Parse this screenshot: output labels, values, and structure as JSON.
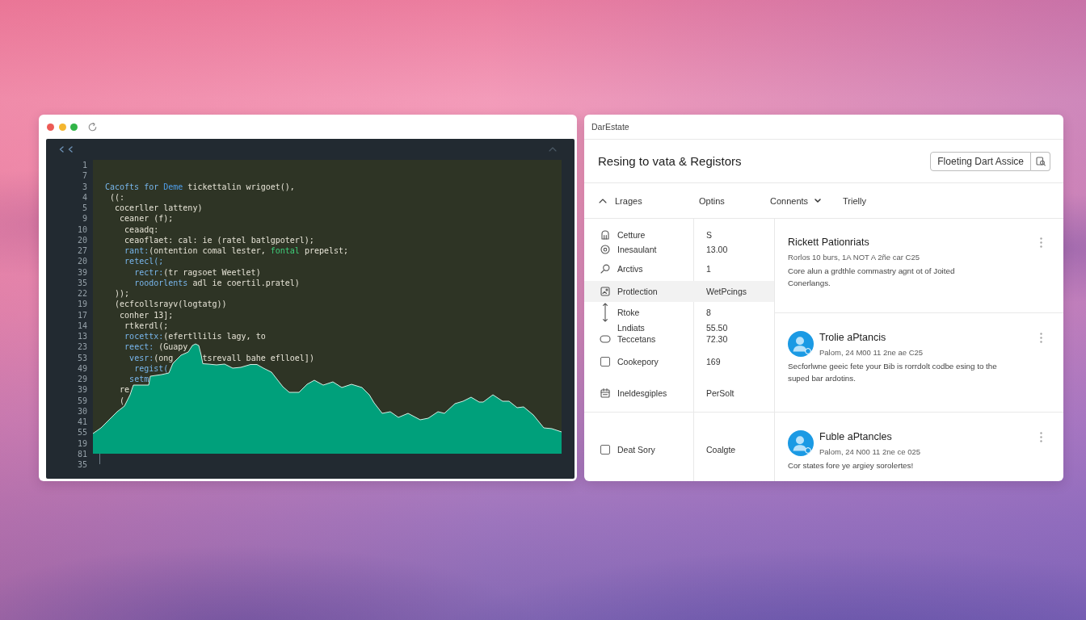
{
  "editor": {
    "code_panel": {
      "lines": [
        {
          "number": "1"
        },
        {
          "number": "7"
        },
        {
          "number": "3",
          "tokens": [
            {
              "kind": "keyword",
              "text": "Cacofts for"
            },
            {
              "kind": "type",
              "text": " Deme"
            },
            {
              "kind": "plain",
              "text": " tickettalin wrigoet(),"
            }
          ]
        },
        {
          "number": "4",
          "tokens": [
            {
              "kind": "plain",
              "text": " ((:"
            }
          ]
        },
        {
          "number": "5",
          "tokens": [
            {
              "kind": "plain",
              "text": "  cocerller latteny)"
            }
          ]
        },
        {
          "number": "9",
          "tokens": [
            {
              "kind": "plain",
              "text": "   ceaner (f);"
            }
          ]
        },
        {
          "number": "10",
          "tokens": [
            {
              "kind": "plain",
              "text": "    ceaadq:"
            }
          ]
        },
        {
          "number": "20",
          "tokens": [
            {
              "kind": "plain",
              "text": "    ceaoflaet: cal: ie (ratel batlgpoterl);"
            }
          ]
        },
        {
          "number": "27",
          "tokens": [
            {
              "kind": "keyword",
              "text": "    rant:"
            },
            {
              "kind": "plain",
              "text": "(ontention comal lester,"
            },
            {
              "kind": "string",
              "text": " fontal"
            },
            {
              "kind": "plain",
              "text": " prepelst;"
            }
          ]
        },
        {
          "number": "20",
          "tokens": [
            {
              "kind": "keyword",
              "text": "    retecl(;"
            }
          ]
        },
        {
          "number": "39",
          "tokens": [
            {
              "kind": "keyword",
              "text": "      rectr:"
            },
            {
              "kind": "plain",
              "text": "(tr ragsoet Weetlet)"
            }
          ]
        },
        {
          "number": "35",
          "tokens": [
            {
              "kind": "keyword",
              "text": "      roodorlents"
            },
            {
              "kind": "plain",
              "text": " adl ie coertil.pratel)"
            }
          ]
        },
        {
          "number": "22",
          "tokens": [
            {
              "kind": "plain",
              "text": "  ));"
            }
          ]
        },
        {
          "number": "19",
          "tokens": [
            {
              "kind": "plain",
              "text": "  (ecfcollsrayv(logtatg))"
            }
          ]
        },
        {
          "number": "17",
          "tokens": [
            {
              "kind": "plain",
              "text": "   conher 13];"
            }
          ]
        },
        {
          "number": "14",
          "tokens": [
            {
              "kind": "plain",
              "text": "    rtkerdl(;"
            }
          ]
        },
        {
          "number": "13",
          "tokens": [
            {
              "kind": "keyword",
              "text": "    rocettx:"
            },
            {
              "kind": "plain",
              "text": "(efertllilis lagy, to"
            }
          ]
        },
        {
          "number": "23",
          "tokens": [
            {
              "kind": "keyword",
              "text": "    reect:"
            },
            {
              "kind": "plain",
              "text": " (Guapy"
            }
          ]
        },
        {
          "number": "53",
          "tokens": [
            {
              "kind": "keyword",
              "text": "     vesr:"
            },
            {
              "kind": "plain",
              "text": "(ong"
            },
            {
              "kind": "plain",
              "text": "      tsrevall bahe eflloel])"
            }
          ]
        },
        {
          "number": "49",
          "tokens": [
            {
              "kind": "keyword",
              "text": "      regist("
            }
          ]
        },
        {
          "number": "29",
          "tokens": [
            {
              "kind": "keyword",
              "text": "     setm"
            }
          ]
        },
        {
          "number": "39",
          "tokens": [
            {
              "kind": "plain",
              "text": "   re"
            }
          ]
        },
        {
          "number": "59",
          "tokens": [
            {
              "kind": "plain",
              "text": "   ("
            }
          ]
        },
        {
          "number": "30"
        },
        {
          "number": "41"
        },
        {
          "number": "55"
        },
        {
          "number": "19"
        }
      ]
    },
    "trailing_lines": [
      {
        "number": "81",
        "cursor": true
      },
      {
        "number": "35",
        "cursor": false
      }
    ]
  },
  "panel": {
    "title": "DarEstate",
    "heading": "Resing to vata & Registors",
    "action": "Floeting Dart Assice",
    "columns": [
      {
        "label": "Lrages",
        "sorted": true,
        "menu": false
      },
      {
        "label": "Optins",
        "sorted": false,
        "menu": false
      },
      {
        "label": "Connents",
        "sorted": false,
        "menu": true
      },
      {
        "label": "Trielly",
        "sorted": false,
        "menu": false
      }
    ],
    "groups": [
      {
        "rows": [
          {
            "kind": "item",
            "label": "Cetture",
            "value": "S",
            "selected": false
          },
          {
            "kind": "item",
            "label": "Inesaulant",
            "value": "13.00",
            "selected": false
          },
          {
            "kind": "item",
            "label": "Arctivs",
            "value": "1",
            "selected": false
          },
          {
            "kind": "item",
            "label": "Protlection",
            "value": "WetPcings",
            "selected": true
          },
          {
            "kind": "item",
            "label": "Rtoke",
            "value": "8",
            "selected": false
          },
          {
            "kind": "item",
            "label": "Lndiats",
            "value": "55.50",
            "selected": false
          },
          {
            "kind": "item",
            "label": "Teccetans",
            "value": "72.30",
            "selected": false
          },
          {
            "kind": "checkbox",
            "label": "Cookepory",
            "value": "169",
            "selected": false,
            "checked": false
          },
          {
            "kind": "item",
            "label": "Ineldesgiples",
            "value": "PerSolt",
            "selected": false
          }
        ]
      },
      {
        "rows": [
          {
            "kind": "checkbox",
            "label": "Deat Sory",
            "value": "Coalgte",
            "selected": false,
            "checked": false
          }
        ]
      }
    ],
    "cards": [
      {
        "avatar": false,
        "title": "Rickett Pationriats",
        "meta": "Rorlos 10 burs, 1A NOT A 2ñe car C25",
        "text": "Core alun a grdthle commastry agnt ot of Joited Conerlangs."
      },
      {
        "avatar": true,
        "title": "Trolie aPtancis",
        "meta": "Palom, 24 M00 11 2ne ae C25",
        "text": "Secforlwne geeic fete your Bib is rorrdolt codbe esing to the suped bar ardotins."
      },
      {
        "avatar": true,
        "title": "Fuble aPtancles",
        "meta": "Palom, 24 N00 11 2ne ce 025",
        "text": "Cor states fore ye argiey sorolertes!"
      }
    ]
  }
}
